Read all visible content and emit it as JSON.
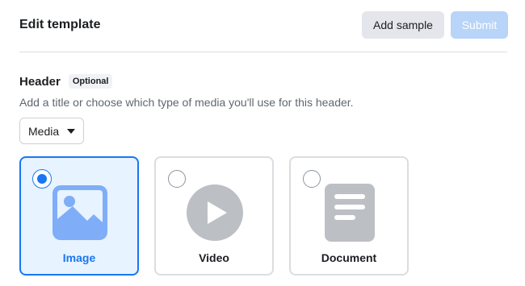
{
  "header": {
    "title": "Edit template",
    "add_sample_label": "Add sample",
    "submit_label": "Submit"
  },
  "section": {
    "title": "Header",
    "badge": "Optional",
    "description": "Add a title or choose which type of media you'll use for this header."
  },
  "media_select": {
    "selected": "Media"
  },
  "media_options": [
    {
      "label": "Image",
      "icon": "image-icon",
      "selected": true
    },
    {
      "label": "Video",
      "icon": "play-icon",
      "selected": false
    },
    {
      "label": "Document",
      "icon": "document-icon",
      "selected": false
    }
  ],
  "colors": {
    "accent": "#1877f2",
    "selected_bg": "#e7f3ff",
    "icon_blue": "#7fadf8",
    "icon_gray": "#bcc0c4",
    "submit_disabled": "#b8d4f8"
  }
}
